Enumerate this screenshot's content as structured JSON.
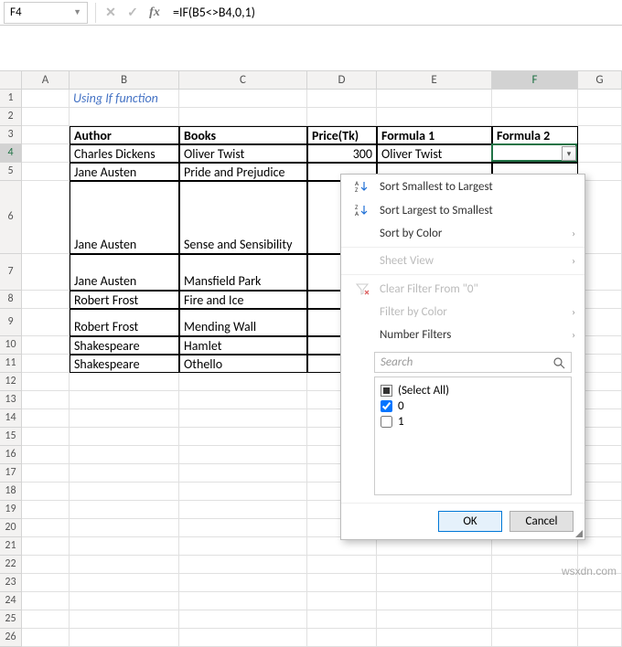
{
  "nameBox": "F4",
  "formula": "=IF(B5<>B4,0,1)",
  "columns": [
    "A",
    "B",
    "C",
    "D",
    "E",
    "F",
    "G"
  ],
  "selectedCol": "F",
  "selectedRow": 4,
  "subtitle": "Using If function",
  "table": {
    "headers": {
      "author": "Author",
      "books": "Books",
      "price": "Price(Tk)",
      "f1": "Formula 1",
      "f2": "Formula 2"
    },
    "rows": [
      {
        "author": "Charles Dickens",
        "books": "Oliver Twist",
        "price": "300",
        "f1": "Oliver Twist"
      },
      {
        "author": "Jane Austen",
        "books": "Pride and Prejudice",
        "price": "",
        "f1": ""
      },
      {
        "author": "Jane Austen",
        "books": "Sense and Sensibility",
        "price": "",
        "f1": ""
      },
      {
        "author": "Jane Austen",
        "books": "Mansfield Park",
        "price": "",
        "f1": ""
      },
      {
        "author": "Robert Frost",
        "books": "Fire and Ice",
        "price": "",
        "f1": ""
      },
      {
        "author": "Robert Frost",
        "books": "Mending Wall",
        "price": "",
        "f1": ""
      },
      {
        "author": "Shakespeare",
        "books": "Hamlet",
        "price": "",
        "f1": ""
      },
      {
        "author": "Shakespeare",
        "books": "Othello",
        "price": "",
        "f1": ""
      }
    ]
  },
  "dropdown": {
    "sortAsc": "Sort Smallest to Largest",
    "sortDesc": "Sort Largest to Smallest",
    "sortColor": "Sort by Color",
    "sheetView": "Sheet View",
    "clearFilter": "Clear Filter From \"0\"",
    "filterColor": "Filter by Color",
    "numberFilters": "Number Filters",
    "searchPlaceholder": "Search",
    "selectAll": "(Select All)",
    "items": [
      {
        "label": "0",
        "checked": true
      },
      {
        "label": "1",
        "checked": false
      }
    ],
    "ok": "OK",
    "cancel": "Cancel"
  },
  "watermark": "wsxdn.com"
}
